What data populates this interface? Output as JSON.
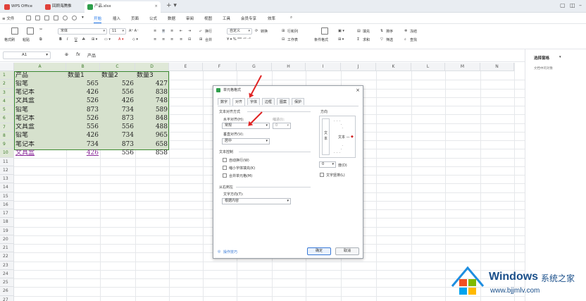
{
  "titlebar": {
    "tabs": [
      {
        "label": "WPS Office"
      },
      {
        "label": "回顾海腾推"
      },
      {
        "label": "产品.xlsx"
      }
    ]
  },
  "menubar": {
    "file": "≡ 文件",
    "items": [
      "开始",
      "插入",
      "页面",
      "公式",
      "数据",
      "审阅",
      "视图",
      "工具",
      "会员专享",
      "效率"
    ],
    "active": "开始"
  },
  "toolbar": {
    "painter": "格式刷",
    "paste": "粘贴",
    "font_name": "宋体",
    "font_size": "11",
    "wrap": "换行",
    "merge": "合并",
    "number_format": "自定义",
    "convert": "转换",
    "rows_cols": "行和列",
    "worksheet": "工作表",
    "cond_format": "条件格式",
    "fill": "填充",
    "sort": "排序",
    "freeze": "冻结",
    "sum": "求和",
    "filter": "筛选",
    "find": "查找"
  },
  "formula": {
    "namebox": "A1",
    "fx": "fx",
    "content": "产品"
  },
  "right_panel": {
    "title": "选择窗格",
    "subtitle": "文档中的对象"
  },
  "columns": [
    "A",
    "B",
    "C",
    "D",
    "E",
    "F",
    "G",
    "H",
    "I",
    "J",
    "K",
    "L",
    "M",
    "N"
  ],
  "rows": [
    "1",
    "2",
    "3",
    "4",
    "5",
    "6",
    "7",
    "8",
    "9",
    "10",
    "11",
    "12",
    "13",
    "14",
    "15",
    "16",
    "17",
    "18",
    "19",
    "20",
    "21",
    "22",
    "23",
    "24",
    "25",
    "26",
    "27"
  ],
  "table": {
    "header": [
      "产品",
      "数量1",
      "数量2",
      "数量3"
    ],
    "data": [
      [
        "铅笔",
        "565",
        "526",
        "427"
      ],
      [
        "笔记本",
        "426",
        "556",
        "838"
      ],
      [
        "文具盒",
        "526",
        "426",
        "748"
      ],
      [
        "铅笔",
        "873",
        "734",
        "589"
      ],
      [
        "笔记本",
        "526",
        "873",
        "848"
      ],
      [
        "文具盒",
        "556",
        "556",
        "488"
      ],
      [
        "铅笔",
        "426",
        "734",
        "965"
      ],
      [
        "笔记本",
        "734",
        "873",
        "658"
      ],
      [
        "文具盒",
        "426",
        "556",
        "858"
      ]
    ]
  },
  "dialog": {
    "title": "单元格格式",
    "tabs": [
      "数字",
      "对齐",
      "字体",
      "边框",
      "图案",
      "保护"
    ],
    "active_tab": "对齐",
    "text_align_section": "文本对齐方式",
    "h_align_label": "水平对齐(H):",
    "h_align_value": "常规",
    "indent_label": "缩进(I):",
    "indent_value": "0",
    "v_align_label": "垂直对齐(V):",
    "v_align_value": "居中",
    "text_control_section": "文本控制",
    "wrap_text": "自动换行(W)",
    "shrink_fit": "缩小字体填充(K)",
    "merge_cells": "合并单元格(M)",
    "rtl_section": "从右到左",
    "text_direction_label": "文字方向(T):",
    "text_direction_value": "根据内容",
    "orientation_section": "方向",
    "vertical_text": "文本",
    "orientation_text": "文本 —",
    "degree_value": "0",
    "degree_label": "度(D)",
    "vertical_text_check": "文字竖排(L)",
    "tips": "操作技巧",
    "ok": "确定",
    "cancel": "取消"
  },
  "watermark": {
    "brand": "Windows",
    "tagline": "系统之家",
    "url": "www.bjjmlv.com"
  }
}
